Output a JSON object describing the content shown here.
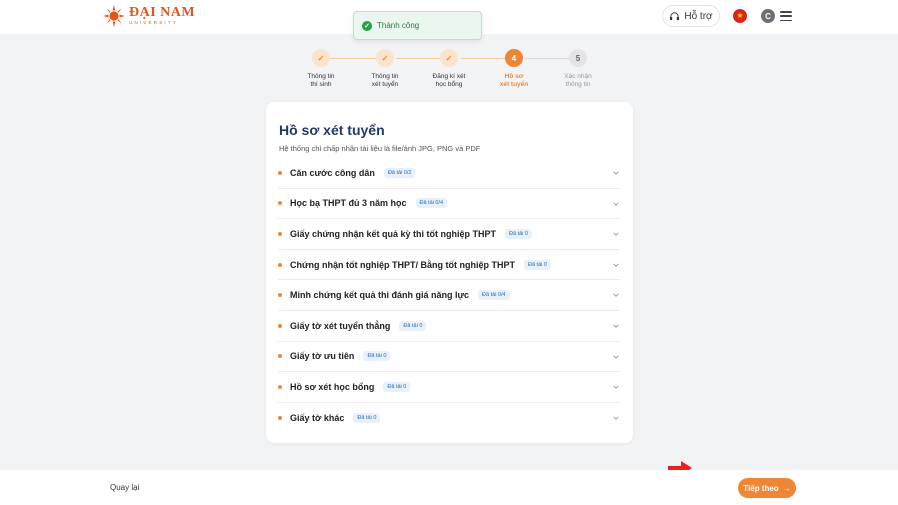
{
  "brand": {
    "name": "ĐẠI NAM",
    "sub": "UNIVERSITY",
    "color": "#e2551b"
  },
  "header": {
    "support_label": "Hỗ trợ",
    "avatar_letter": "C",
    "flag_icon": "vietnam-flag-icon"
  },
  "toast": {
    "message": "Thành công"
  },
  "stepper": {
    "steps": [
      {
        "number": "1",
        "label_line1": "Thông tin",
        "label_line2": "thí sinh",
        "status": "done"
      },
      {
        "number": "2",
        "label_line1": "Thông tin",
        "label_line2": "xét tuyển",
        "status": "done"
      },
      {
        "number": "3",
        "label_line1": "Đăng kí xét",
        "label_line2": "học bổng",
        "status": "done"
      },
      {
        "number": "4",
        "label_line1": "Hồ sơ",
        "label_line2": "xét tuyển",
        "status": "active"
      },
      {
        "number": "5",
        "label_line1": "Xác nhận",
        "label_line2": "thông tin",
        "status": "pending"
      }
    ]
  },
  "card": {
    "title": "Hồ sơ xét tuyển",
    "subtitle": "Hệ thống chỉ chấp nhận tài liệu là file/ảnh JPG, PNG và PDF",
    "documents": [
      {
        "name": "Căn cước công dân",
        "badge": "Đã tải 0/2"
      },
      {
        "name": "Học bạ THPT đủ 3 năm học",
        "badge": "Đã tải 0/4"
      },
      {
        "name": "Giấy chứng nhận kết quả kỳ thi tốt nghiệp THPT",
        "badge": "Đã tải 0"
      },
      {
        "name": "Chứng nhận tốt nghiệp THPT/ Bằng tốt nghiệp THPT",
        "badge": "Đã tải 0"
      },
      {
        "name": "Minh chứng kết quả thi đánh giá năng lực",
        "badge": "Đã tải 0/4"
      },
      {
        "name": "Giấy tờ xét tuyển thẳng",
        "badge": "Đã tải 0"
      },
      {
        "name": "Giấy tờ ưu tiên",
        "badge": "Đã tải 0"
      },
      {
        "name": "Hồ sơ xét học bổng",
        "badge": "Đã tải 0"
      },
      {
        "name": "Giấy tờ khác",
        "badge": "Đã tải 0"
      }
    ]
  },
  "footer": {
    "back_label": "Quay lại",
    "next_label": "Tiếp theo"
  },
  "colors": {
    "accent": "#ef8636",
    "title": "#1f3a68",
    "success": "#27a046"
  }
}
